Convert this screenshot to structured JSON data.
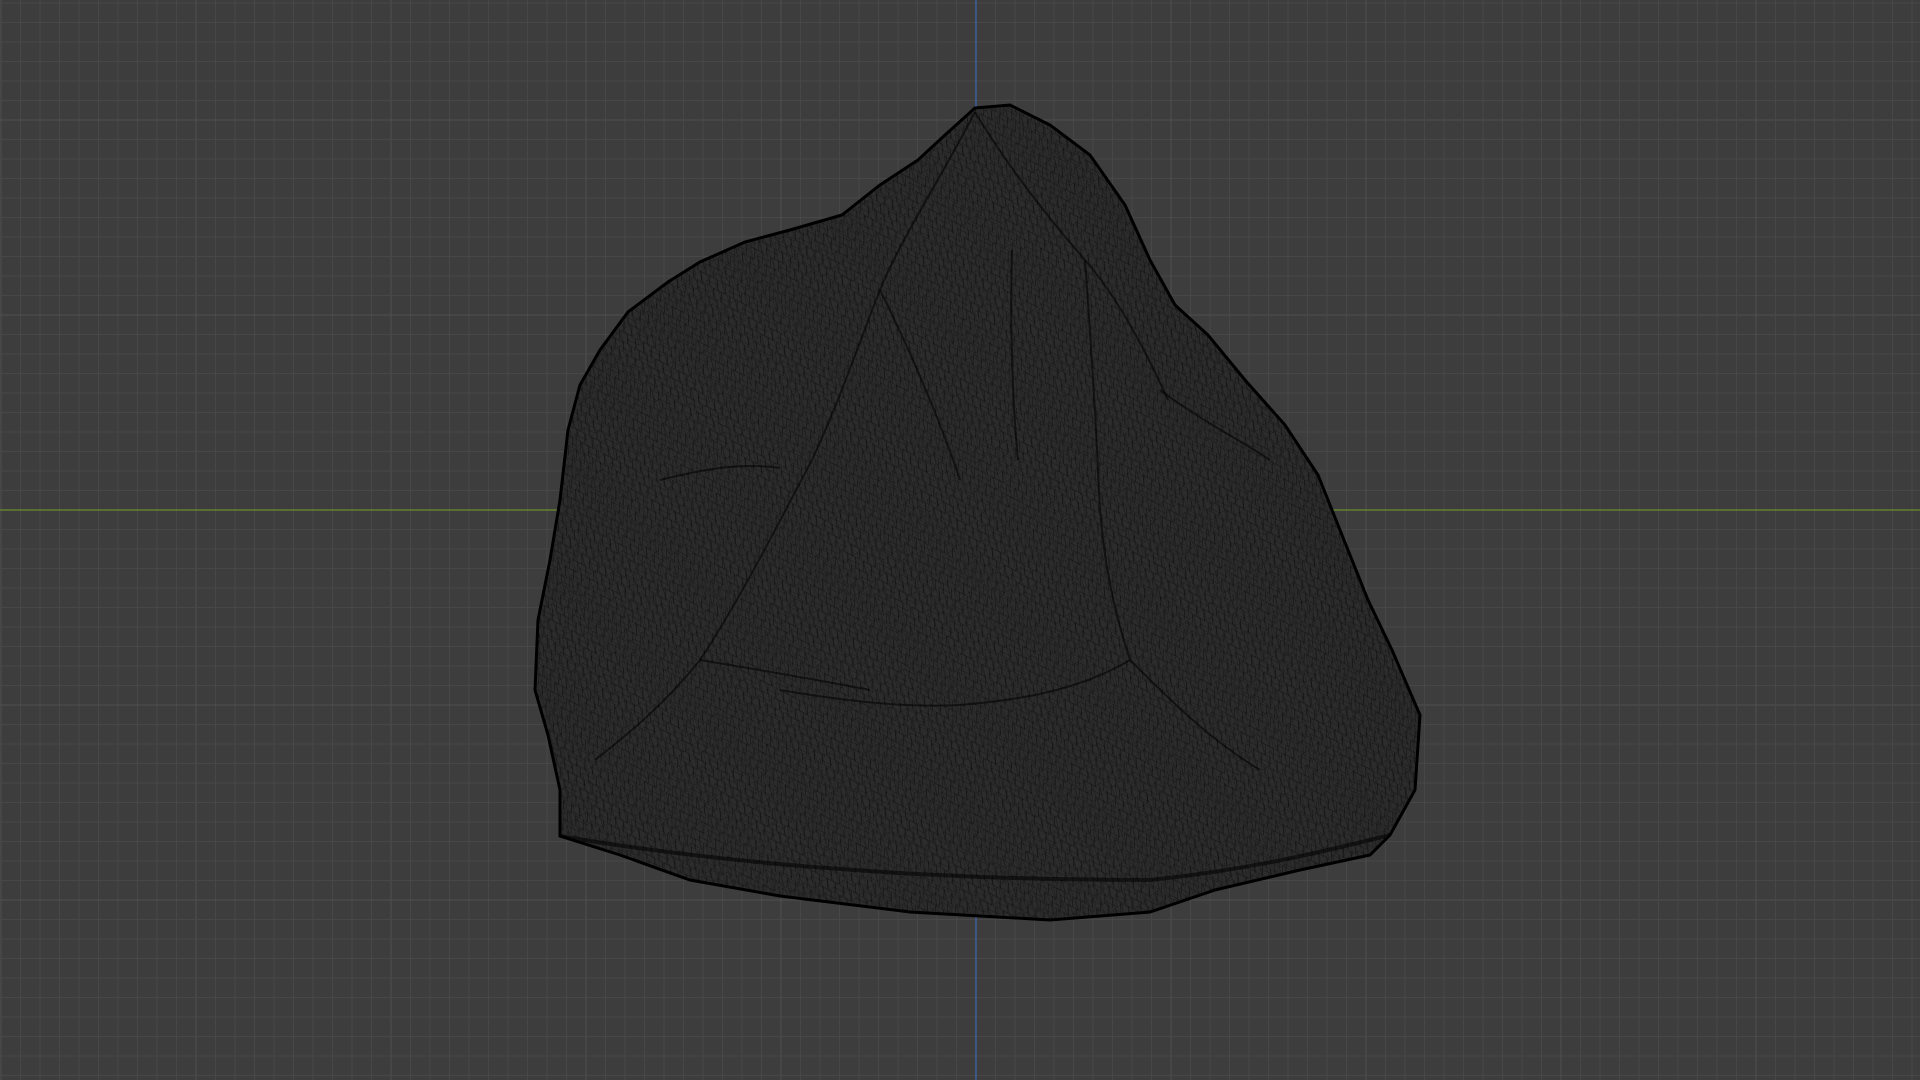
{
  "viewport": {
    "view": "front",
    "shading": "wireframe",
    "background_color": "#3d3d3d",
    "grid_minor_color": "#474747",
    "grid_major_color": "#505050",
    "axis_x_color": "#6b8e2a",
    "axis_z_color": "#3d68b5"
  },
  "object": {
    "name": "rock-mesh",
    "wire_color": "#000000",
    "fill_color": "#2c2c2c"
  }
}
